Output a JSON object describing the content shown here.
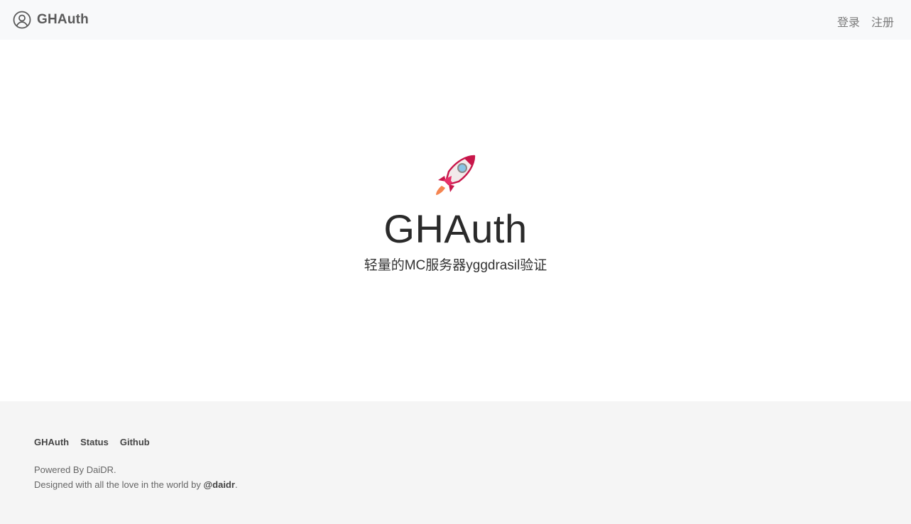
{
  "navbar": {
    "brand": "GHAuth",
    "brand_icon": "user-circle-icon",
    "links": [
      "登录",
      "注册"
    ]
  },
  "hero": {
    "icon": "rocket-icon",
    "title": "GHAuth",
    "subtitle": "轻量的MC服务器yggdrasil验证"
  },
  "footer": {
    "links": [
      "GHAuth",
      "Status",
      "Github"
    ],
    "powered": "Powered By DaiDR.",
    "designed_prefix": "Designed with all the love in the world by ",
    "author": "@daidr",
    "designed_suffix": "."
  },
  "colors": {
    "navbar_bg": "#f8f9fa",
    "footer_bg": "#f5f5f5",
    "rocket_red": "#c8164a",
    "rocket_window": "#88c4e6",
    "flame": "#f58450"
  }
}
